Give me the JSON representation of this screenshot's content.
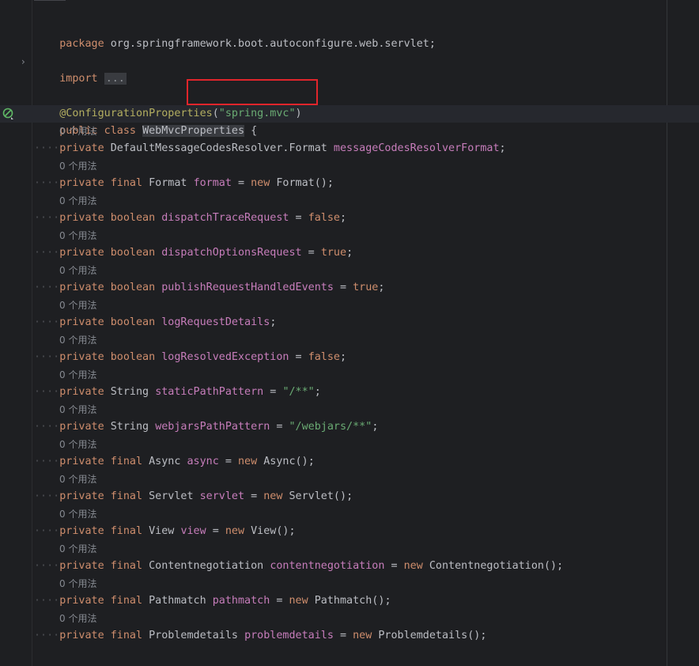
{
  "code": {
    "package_kw": "package",
    "package_name": "org.springframework.boot.autoconfigure.web.servlet",
    "semicolon": ";",
    "import_kw": "import",
    "import_fold": "...",
    "annotation": "@ConfigurationProperties",
    "paren_open": "(",
    "annotation_value": "\"spring.mvc\"",
    "paren_close": ")",
    "class_mods": "public class",
    "class_name": "WebMvcProperties",
    "brace_open": "{",
    "usage_hint": "0 个用法",
    "fields": [
      {
        "mods": "private",
        "type": "DefaultMessageCodesResolver.Format",
        "name": "messageCodesResolverFormat",
        "init": ""
      },
      {
        "mods": "private final",
        "type": "Format",
        "name": "format",
        "init": "new Format()"
      },
      {
        "mods": "private boolean",
        "type": "",
        "name": "dispatchTraceRequest",
        "init": "false"
      },
      {
        "mods": "private boolean",
        "type": "",
        "name": "dispatchOptionsRequest",
        "init": "true"
      },
      {
        "mods": "private boolean",
        "type": "",
        "name": "publishRequestHandledEvents",
        "init": "true"
      },
      {
        "mods": "private boolean",
        "type": "",
        "name": "logRequestDetails",
        "init": ""
      },
      {
        "mods": "private boolean",
        "type": "",
        "name": "logResolvedException",
        "init": "false"
      },
      {
        "mods": "private",
        "type": "String",
        "name": "staticPathPattern",
        "init": "\"/**\""
      },
      {
        "mods": "private",
        "type": "String",
        "name": "webjarsPathPattern",
        "init": "\"/webjars/**\""
      },
      {
        "mods": "private final",
        "type": "Async",
        "name": "async",
        "init": "new Async()"
      },
      {
        "mods": "private final",
        "type": "Servlet",
        "name": "servlet",
        "init": "new Servlet()"
      },
      {
        "mods": "private final",
        "type": "View",
        "name": "view",
        "init": "new View()"
      },
      {
        "mods": "private final",
        "type": "Contentnegotiation",
        "name": "contentnegotiation",
        "init": "new Contentnegotiation()"
      },
      {
        "mods": "private final",
        "type": "Pathmatch",
        "name": "pathmatch",
        "init": "new Pathmatch()"
      },
      {
        "mods": "private final",
        "type": "Problemdetails",
        "name": "problemdetails",
        "init": "new Problemdetails()"
      }
    ]
  },
  "colors": {
    "background": "#1e1f22",
    "keyword": "#cf8e6d",
    "annotation": "#b3ae60",
    "string": "#6aab73",
    "field": "#c77dbb",
    "highlight_box": "#e0252b"
  },
  "icons": {
    "fold_arrow": "chevron-right-icon",
    "gutter_bean": "spring-bean-icon"
  }
}
